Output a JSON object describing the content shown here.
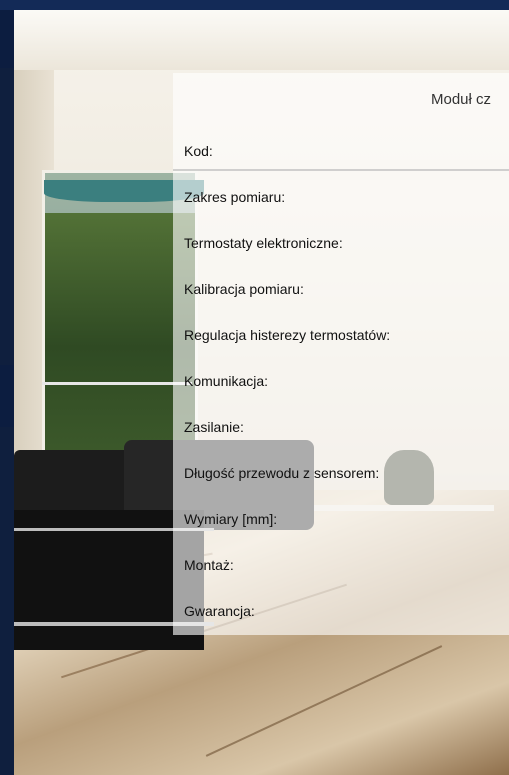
{
  "panel": {
    "title": "Moduł cz",
    "specs": [
      {
        "label": "Kod:"
      },
      {
        "label": "Zakres pomiaru:"
      },
      {
        "label": "Termostaty elektroniczne:"
      },
      {
        "label": "Kalibracja pomiaru:"
      },
      {
        "label": "Regulacja histerezy termostatów:"
      },
      {
        "label": "Komunikacja:"
      },
      {
        "label": "Zasilanie:"
      },
      {
        "label": "Długość przewodu z sensorem:"
      },
      {
        "label": "Wymiary [mm]:"
      },
      {
        "label": "Montaż:"
      },
      {
        "label": "Gwarancja:"
      }
    ]
  },
  "colors": {
    "navy": "#132a57",
    "panel_bg": "rgba(255,255,255,0.62)",
    "text": "#111111"
  }
}
